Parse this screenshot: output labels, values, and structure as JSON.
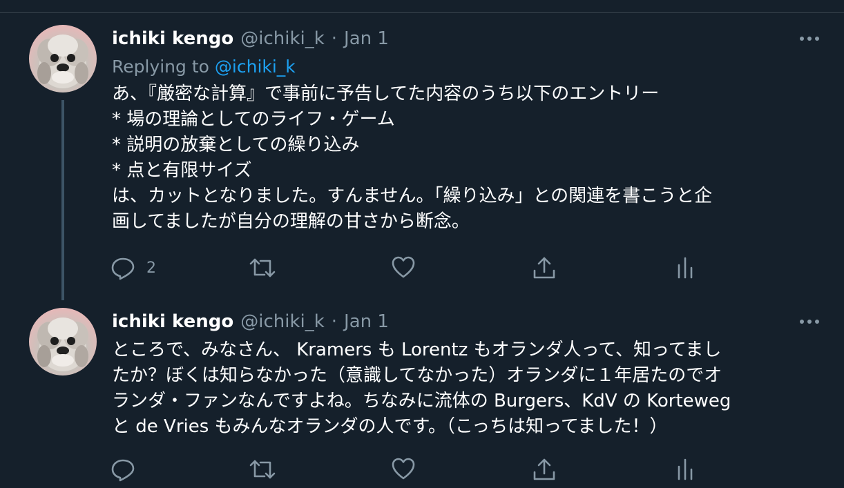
{
  "tweets": [
    {
      "name": "ichiki kengo",
      "handle": "@ichiki_k",
      "separator": "·",
      "date": "Jan 1",
      "replying_prefix": "Replying to",
      "replying_to": "@ichiki_k",
      "lines": [
        "あ、『厳密な計算』で事前に予告してた内容のうち以下のエントリー",
        "* 場の理論としてのライフ・ゲーム",
        "* 説明の放棄としての繰り込み",
        "* 点と有限サイズ",
        "は、カットとなりました。すんません。「繰り込み」との関連を書こうと企",
        "画してましたが自分の理解の甘さから断念。"
      ],
      "reply_count": "2"
    },
    {
      "name": "ichiki kengo",
      "handle": "@ichiki_k",
      "separator": "·",
      "date": "Jan 1",
      "lines": [
        "ところで、みなさん、 Kramers も Lorentz もオランダ人って、知ってまし",
        "たか？ぼくは知らなかった（意識してなかった）オランダに１年居たのでオ",
        "ランダ・ファンなんですよね。ちなみに流体の Burgers、KdV の Korteweg",
        "と de Vries もみんなオランダの人です。（こっちは知ってました！）"
      ]
    }
  ],
  "icons": {
    "reply": "reply-icon",
    "retweet": "retweet-icon",
    "like": "heart-icon",
    "share": "share-icon",
    "analytics": "analytics-icon",
    "more": "more-icon"
  },
  "colors": {
    "background": "#15202b",
    "secondary_text": "#8899a6",
    "link": "#1da1f2",
    "thread_line": "#3d5466"
  }
}
